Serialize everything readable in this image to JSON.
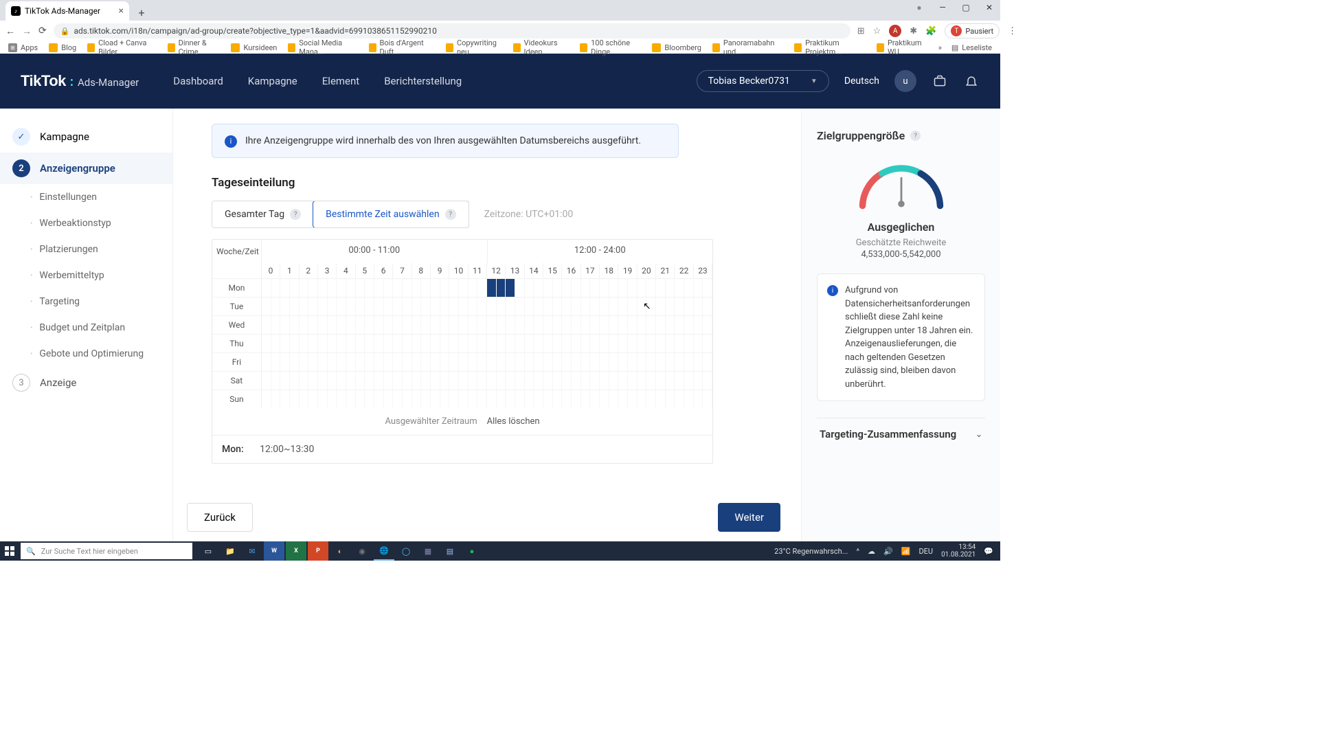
{
  "browser": {
    "tab_title": "TikTok Ads-Manager",
    "url": "ads.tiktok.com/i18n/campaign/ad-group/create?objective_type=1&aadvid=6991038651152990210",
    "paused_label": "Pausiert",
    "bookmarks": [
      "Apps",
      "Blog",
      "Cload + Canva Bilder",
      "Dinner & Crime",
      "Kursideen",
      "Social Media Mana...",
      "Bois d'Argent Duft...",
      "Copywriting neu",
      "Videokurs Ideen",
      "100 schöne Dinge",
      "Bloomberg",
      "Panoramabahn und...",
      "Praktikum Projektm...",
      "Praktikum WU"
    ],
    "readlist": "Leseliste"
  },
  "header": {
    "brand": "TikTok",
    "brand_sub": "Ads-Manager",
    "nav": [
      "Dashboard",
      "Kampagne",
      "Element",
      "Berichterstellung"
    ],
    "account": "Tobias Becker0731",
    "lang": "Deutsch",
    "avatar_initial": "u"
  },
  "sidebar": {
    "step1": "Kampagne",
    "step2": "Anzeigengruppe",
    "step3": "Anzeige",
    "subs": [
      "Einstellungen",
      "Werbeaktionstyp",
      "Platzierungen",
      "Werbemitteltyp",
      "Targeting",
      "Budget und Zeitplan",
      "Gebote und Optimierung"
    ]
  },
  "content": {
    "info_text": "Ihre Anzeigengruppe wird innerhalb des von Ihren ausgewählten Datumsbereichs ausgeführt.",
    "section_title": "Tageseinteilung",
    "toggle_all_day": "Gesamter Tag",
    "toggle_select_time": "Bestimmte Zeit auswählen",
    "timezone": "Zeitzone: UTC+01:00",
    "week_time": "Woche/Zeit",
    "span_am": "00:00 - 11:00",
    "span_pm": "12:00 - 24:00",
    "hours": [
      "0",
      "1",
      "2",
      "3",
      "4",
      "5",
      "6",
      "7",
      "8",
      "9",
      "10",
      "11",
      "12",
      "13",
      "14",
      "15",
      "16",
      "17",
      "18",
      "19",
      "20",
      "21",
      "22",
      "23"
    ],
    "days": [
      "Mon",
      "Tue",
      "Wed",
      "Thu",
      "Fri",
      "Sat",
      "Sun"
    ],
    "selected_label": "Ausgewählter Zeitraum",
    "clear_all": "Alles löschen",
    "selected_day": "Mon:",
    "selected_range": "12:00~13:30",
    "back": "Zurück",
    "next": "Weiter"
  },
  "right": {
    "title": "Zielgruppengröße",
    "status": "Ausgeglichen",
    "sub": "Geschätzte Reichweite",
    "value": "4,533,000-5,542,000",
    "note": "Aufgrund von Datensicherheitsanforderungen schließt diese Zahl keine Zielgruppen unter 18 Jahren ein. Anzeigenauslieferungen, die nach geltenden Gesetzen zulässig sind, bleiben davon unberührt.",
    "collapse": "Targeting-Zusammenfassung"
  },
  "taskbar": {
    "search_placeholder": "Zur Suche Text hier eingeben",
    "weather": "23°C  Regenwahrsch...",
    "lang": "DEU",
    "time": "13:54",
    "date": "01.08.2021"
  },
  "schedule_selection": {
    "Mon": [
      24,
      25,
      26
    ]
  }
}
